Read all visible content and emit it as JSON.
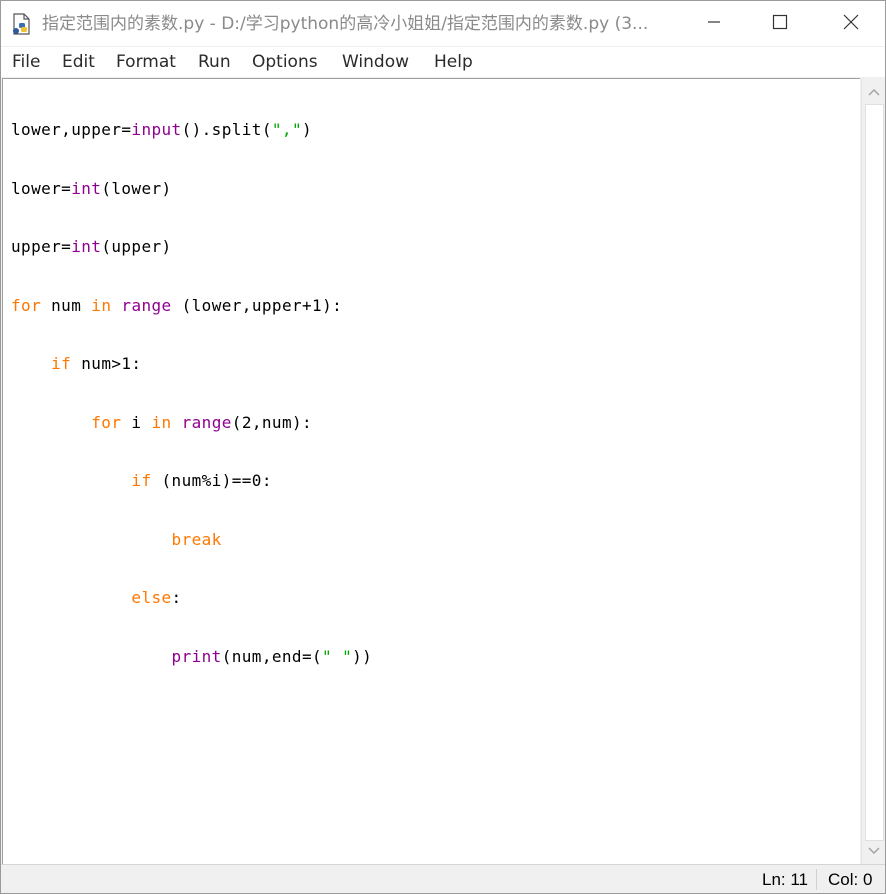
{
  "window": {
    "title": "指定范围内的素数.py - D:/学习python的高冷小姐姐/指定范围内的素数.py (3...",
    "icon": "python-file-icon",
    "controls": [
      "minimize-icon",
      "maximize-icon",
      "close-icon"
    ]
  },
  "menu": {
    "file": "File",
    "edit": "Edit",
    "format": "Format",
    "run": "Run",
    "options": "Options",
    "window": "Window",
    "help": "Help"
  },
  "code": {
    "l1_a": "lower,upper=",
    "l1_b": "input",
    "l1_c": "().split(",
    "l1_d": "\",\"",
    "l1_e": ")",
    "l2_a": "lower=",
    "l2_b": "int",
    "l2_c": "(lower)",
    "l3_a": "upper=",
    "l3_b": "int",
    "l3_c": "(upper)",
    "l4_a": "for",
    "l4_b": " num ",
    "l4_c": "in",
    "l4_d": " ",
    "l4_e": "range",
    "l4_f": " (lower,upper+1):",
    "l5_a": "    ",
    "l5_b": "if",
    "l5_c": " num>1:",
    "l6_a": "        ",
    "l6_b": "for",
    "l6_c": " i ",
    "l6_d": "in",
    "l6_e": " ",
    "l6_f": "range",
    "l6_g": "(2,num):",
    "l7_a": "            ",
    "l7_b": "if",
    "l7_c": " (num%i)==0:",
    "l8_a": "                ",
    "l8_b": "break",
    "l9_a": "            ",
    "l9_b": "else",
    "l9_c": ":",
    "l10_a": "                ",
    "l10_b": "print",
    "l10_c": "(num,end=(",
    "l10_d": "\" \"",
    "l10_e": "))"
  },
  "syntax_colors": {
    "keyword": "#ff7700",
    "builtin": "#900090",
    "string": "#00aa00",
    "default": "#000000"
  },
  "status": {
    "ln": "Ln: 11",
    "col": "Col: 0"
  }
}
